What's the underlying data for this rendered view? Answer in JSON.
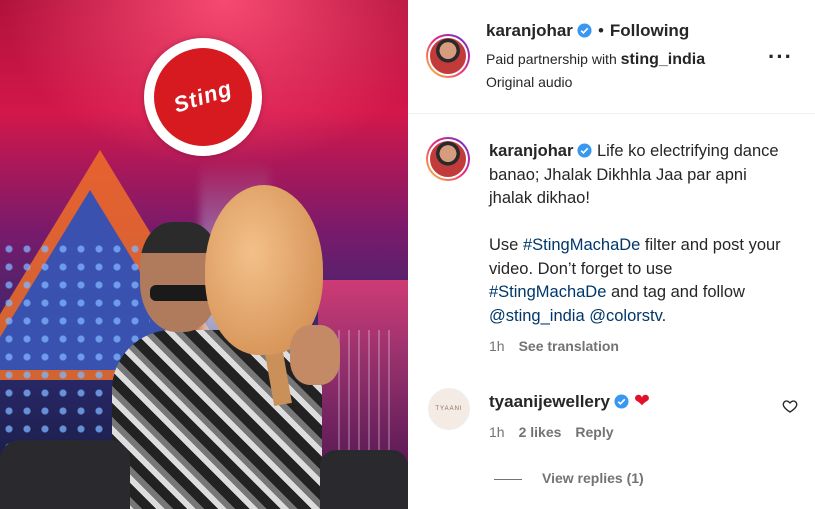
{
  "media": {
    "brand_logo_text": "Sting"
  },
  "header": {
    "username": "karanjohar",
    "separator": "•",
    "follow_status": "Following",
    "partnership_prefix": "Paid partnership with",
    "partner": "sting_india",
    "audio": "Original audio",
    "more_icon": "more-horizontal-icon"
  },
  "caption": {
    "username": "karanjohar",
    "text1": "Life ko electrifying dance banao; Jhalak Dikhhla Jaa par apni jhalak dikhao!",
    "line2_prefix": "Use ",
    "tag1": "#StingMachaDe",
    "line2_mid": " filter and post your video. Don’t forget to use ",
    "tag2": "#StingMachaDe",
    "line2_mid2": " and tag and follow ",
    "mention1": "@sting_india",
    "space": " ",
    "mention2": "@colorstv",
    "period": ".",
    "time": "1h",
    "see_translation": "See translation"
  },
  "comment": {
    "avatar_text": "TYAANI",
    "username": "tyaanijewellery",
    "emoji": "❤",
    "time": "1h",
    "likes": "2 likes",
    "reply": "Reply",
    "view_replies": "View replies (1)"
  },
  "colors": {
    "verified": "#3897f0",
    "link": "#00376b",
    "muted": "#737373",
    "heart": "#e3102b"
  }
}
